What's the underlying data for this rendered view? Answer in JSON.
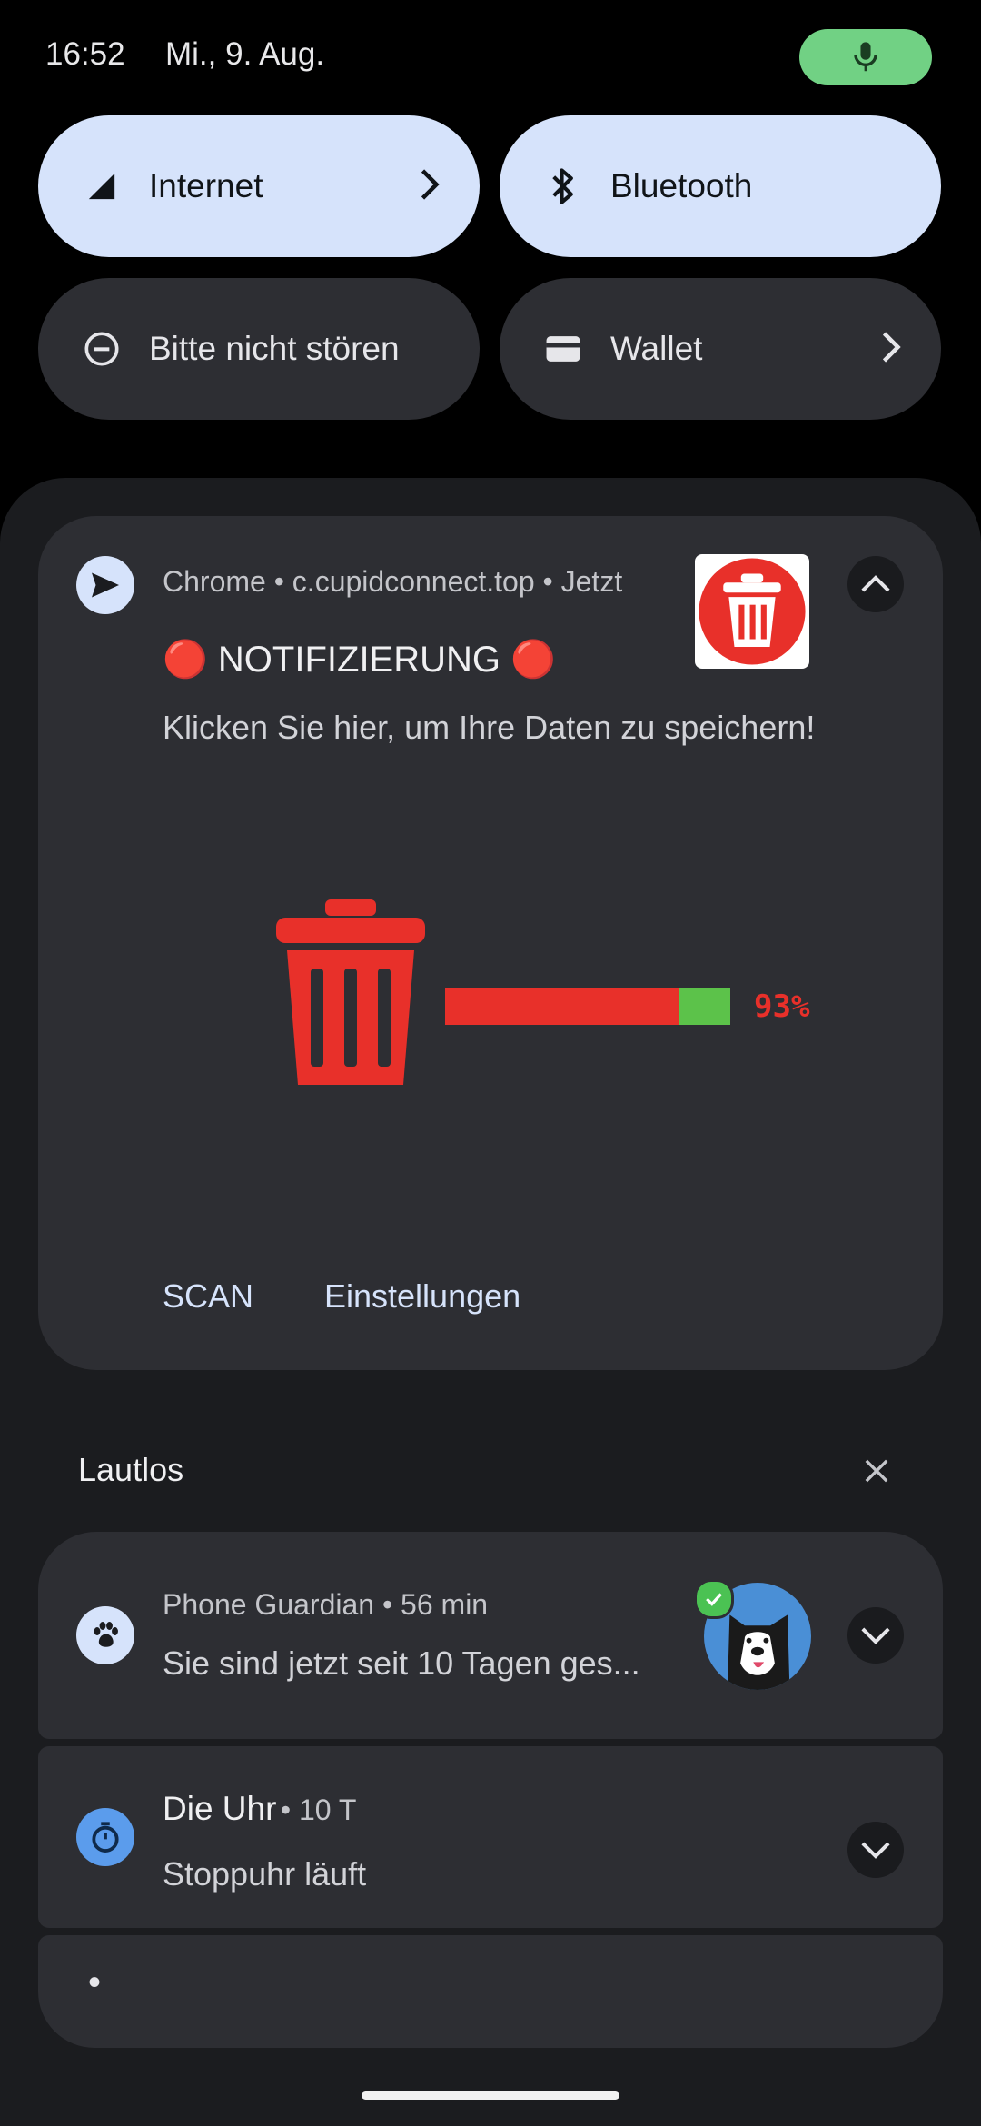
{
  "status_bar": {
    "time": "16:52",
    "date": "Mi., 9. Aug."
  },
  "quick_settings": {
    "tiles": [
      {
        "label": "Internet",
        "state": "on",
        "icon": "signal-icon",
        "has_chevron": true
      },
      {
        "label": "Bluetooth",
        "state": "on",
        "icon": "bluetooth-icon",
        "has_chevron": false
      },
      {
        "label": "Bitte nicht stören",
        "state": "off",
        "icon": "do-not-disturb-icon",
        "has_chevron": false
      },
      {
        "label": "Wallet",
        "state": "off",
        "icon": "wallet-icon",
        "has_chevron": true
      }
    ]
  },
  "notifications": {
    "chrome": {
      "app": "Chrome",
      "source": "c.cupidconnect.top",
      "time": "Jetzt",
      "title": "🔴 NOTIFIZIERUNG 🔴",
      "text": "Klicken Sie hier, um Ihre Daten zu speichern!",
      "progress_label": "93%",
      "progress_value": 0.93,
      "actions": [
        "SCAN",
        "Einstellungen"
      ]
    },
    "silent_header": "Lautlos",
    "phone_guardian": {
      "app": "Phone Guardian",
      "time": "56 min",
      "text": "Sie sind jetzt seit 10 Tagen ges..."
    },
    "clock": {
      "app": "Die Uhr",
      "time": "10 T",
      "text": "Stoppuhr läuft"
    },
    "collapsed_dot": "•"
  },
  "colors": {
    "tile_on": "#d6e3fb",
    "tile_off": "#2d2e33",
    "accent_green": "#71d184",
    "alert_red": "#e8302a"
  }
}
